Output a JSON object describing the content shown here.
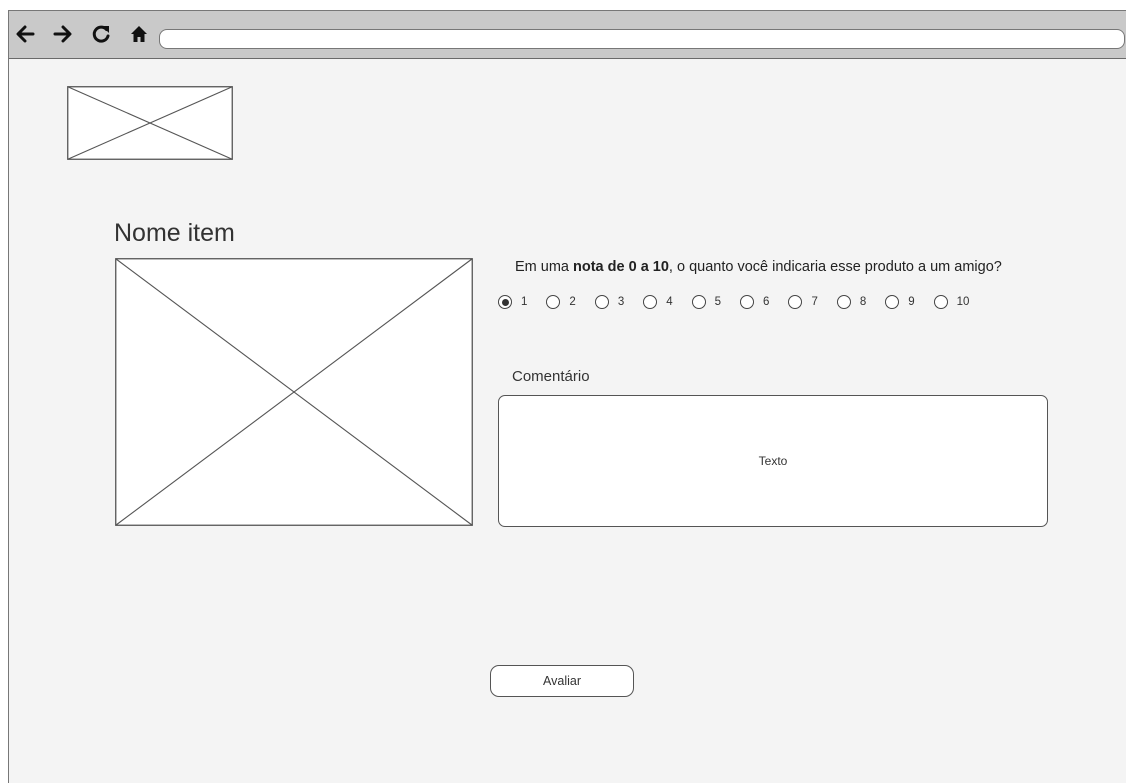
{
  "browser": {
    "back_icon": "arrow-left-icon",
    "forward_icon": "arrow-right-icon",
    "reload_icon": "reload-icon",
    "home_icon": "home-icon",
    "address_value": ""
  },
  "logo": {
    "type": "placeholder-image"
  },
  "product": {
    "name": "Nome item",
    "image": "placeholder-image"
  },
  "question": {
    "prefix": "Em uma ",
    "bold": "nota de 0 a 10",
    "suffix": ", o quanto você indicaria esse produto a um amigo?"
  },
  "rating": {
    "selected": "1",
    "options": [
      "1",
      "2",
      "3",
      "4",
      "5",
      "6",
      "7",
      "8",
      "9",
      "10"
    ]
  },
  "comment": {
    "label": "Comentário",
    "placeholder": "Texto"
  },
  "submit": {
    "label": "Avaliar"
  }
}
